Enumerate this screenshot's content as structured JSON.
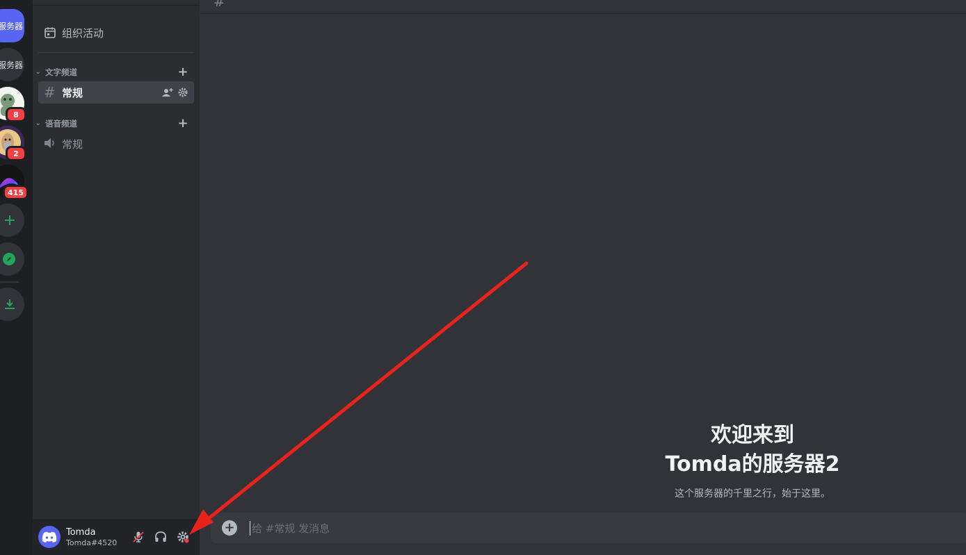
{
  "rail": {
    "servers": [
      {
        "label": "服务器",
        "active": true
      },
      {
        "label": "服务器",
        "active": false
      },
      {
        "badge": "8"
      },
      {
        "badge": "2"
      },
      {
        "badge": "415"
      }
    ],
    "add_server_icon": "plus-icon",
    "explore_icon": "compass-icon",
    "download_icon": "download-icon"
  },
  "sidebar": {
    "events_label": "组织活动",
    "categories": [
      {
        "label": "文字频道",
        "channels": [
          {
            "name": "常规",
            "type": "text",
            "selected": true
          }
        ]
      },
      {
        "label": "语音频道",
        "channels": [
          {
            "name": "常规",
            "type": "voice",
            "selected": false
          }
        ]
      }
    ]
  },
  "user": {
    "name": "Tomda",
    "tag": "Tomda#4520"
  },
  "main": {
    "welcome_line1": "欢迎来到",
    "welcome_line2": "Tomda的服务器2",
    "welcome_sub": "这个服务器的千里之行，始于这里。",
    "composer_placeholder": "给 #常规 发消息"
  },
  "colors": {
    "accent": "#5865f2",
    "annotation_arrow": "#e8231c",
    "badge": "#f23f43",
    "green": "#23a559"
  }
}
